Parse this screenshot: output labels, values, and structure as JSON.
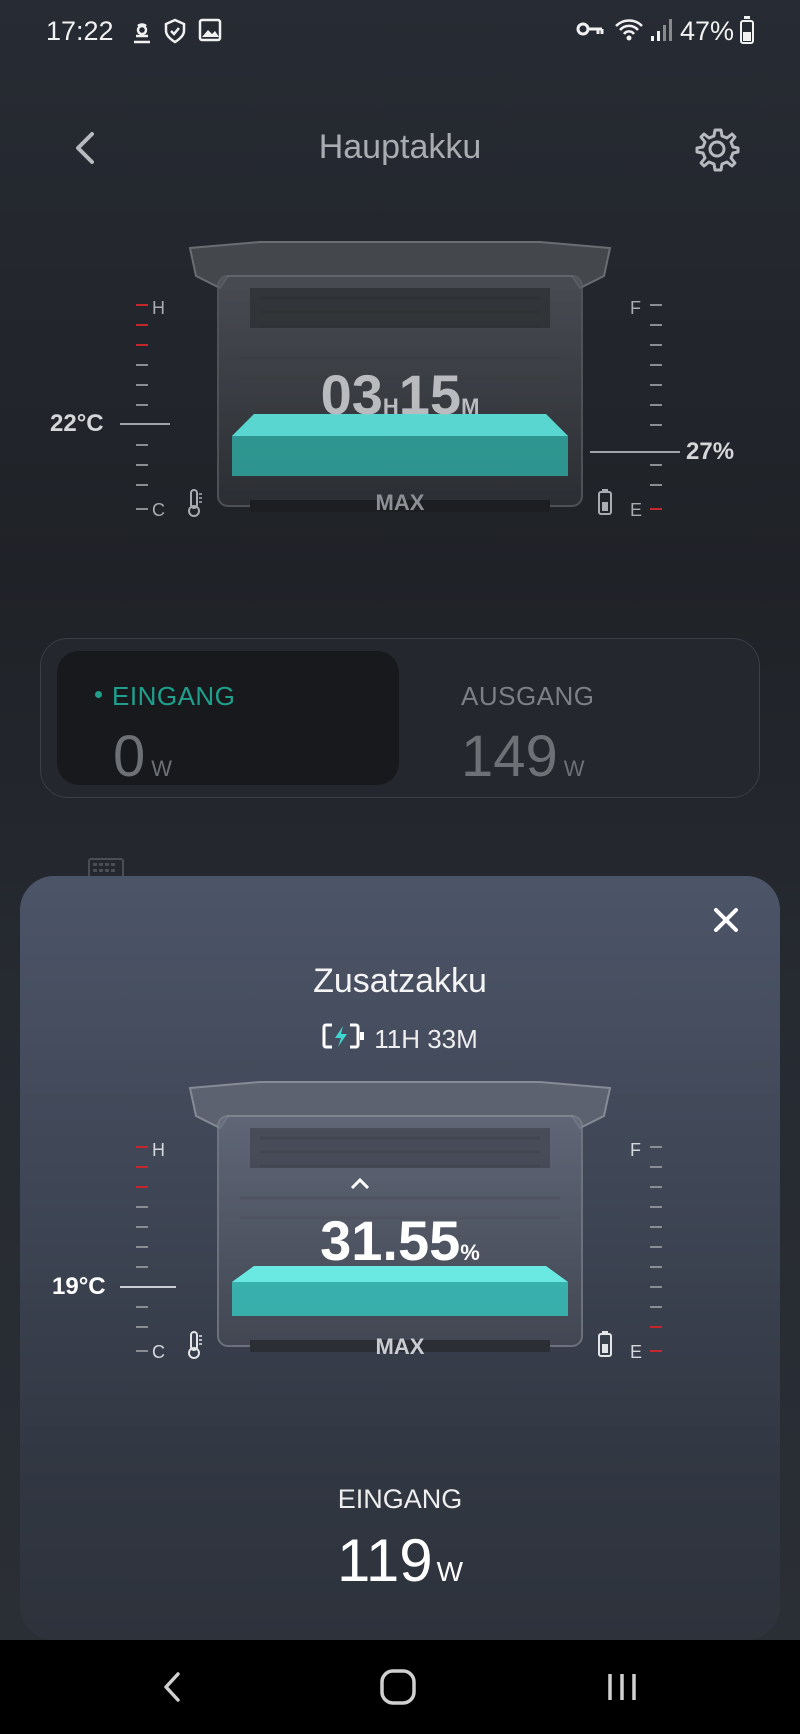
{
  "status_bar": {
    "time": "17:22",
    "battery_percent": "47%",
    "icons": [
      "alarm-icon",
      "shield-icon",
      "image-icon",
      "vpn-key-icon",
      "wifi-icon",
      "signal-icon",
      "battery-icon"
    ]
  },
  "header": {
    "title": "Hauptakku",
    "back_icon": "back-arrow-icon",
    "settings_icon": "gear-icon"
  },
  "main_battery": {
    "time_hours": "03",
    "hours_unit": "H",
    "time_minutes": "15",
    "minutes_unit": "M",
    "max_label": "MAX",
    "temp_gauge": {
      "top": "H",
      "bottom": "C",
      "reading": "22°C",
      "level": 0.45
    },
    "charge_gauge": {
      "top": "F",
      "bottom": "E",
      "reading": "27%",
      "level": 0.27
    }
  },
  "power": {
    "input_label": "EINGANG",
    "input_value": "0",
    "input_unit": "W",
    "output_label": "AUSGANG",
    "output_value": "149",
    "output_unit": "W"
  },
  "extra_battery_sheet": {
    "title": "Zusatzakku",
    "charge_time": "11H 33M",
    "percent_value": "31.55",
    "percent_unit": "%",
    "max_label": "MAX",
    "temp_gauge": {
      "top": "H",
      "bottom": "C",
      "reading": "19°C",
      "level": 0.3
    },
    "charge_gauge": {
      "top": "F",
      "bottom": "E",
      "level": 0.3155
    },
    "input_label": "EINGANG",
    "input_value": "119",
    "input_unit": "W"
  },
  "colors": {
    "accent_teal": "#1fa08c",
    "fill_cyan": "#3fd6cf",
    "warn_red": "#c4262b"
  }
}
